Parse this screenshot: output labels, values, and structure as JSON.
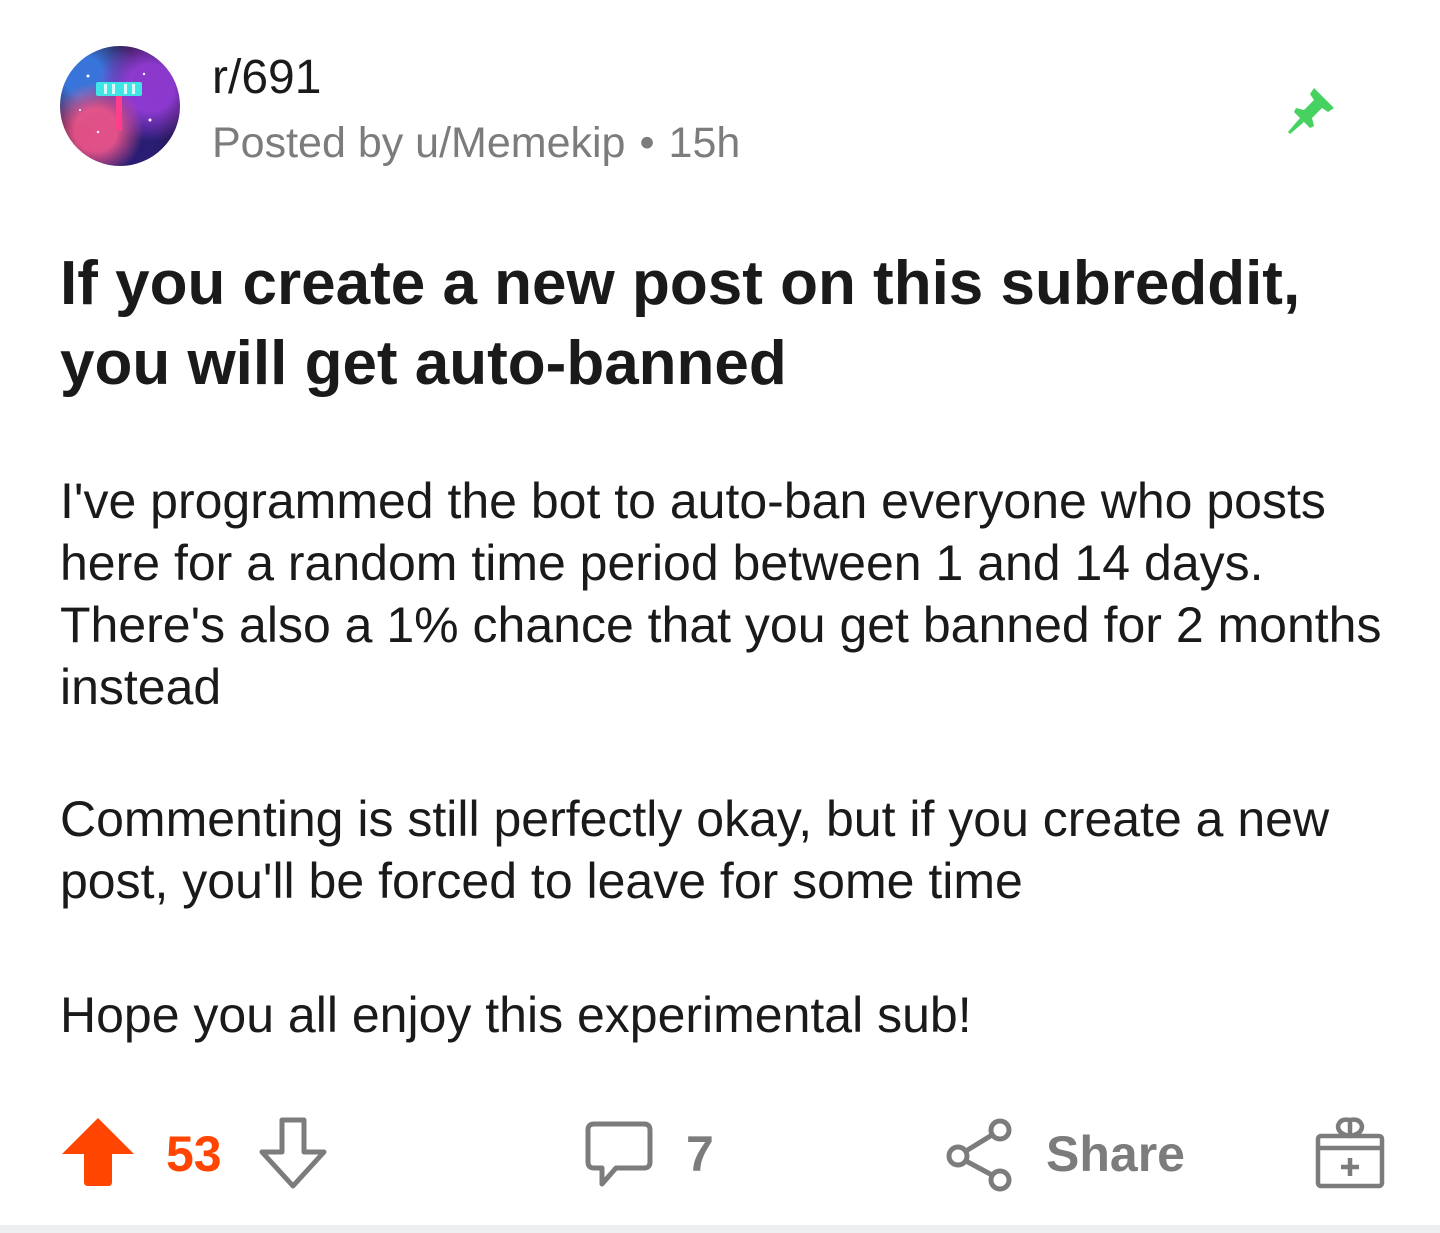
{
  "header": {
    "subreddit": "r/691",
    "posted_by": "Posted by u/Memekip",
    "separator": "•",
    "age": "15h"
  },
  "post": {
    "title": "If you create a new post on this subreddit, you will get auto-banned",
    "paragraphs": [
      "I've programmed the bot to auto-ban everyone who posts here for a random time period between 1 and 14 days. There's also a 1% chance that you get banned for 2 months instead",
      "Commenting is still perfectly okay, but if you create a new post, you'll be forced to leave for some time",
      "Hope you all enjoy this experimental sub!"
    ]
  },
  "actions": {
    "score": "53",
    "comment_count": "7",
    "share_label": "Share"
  },
  "colors": {
    "upvote_active": "#ff4500",
    "pin": "#46d160",
    "muted": "#7c7c7c",
    "text": "#1a1a1b"
  },
  "icons": {
    "avatar": "subreddit-avatar",
    "pin": "pin-icon",
    "upvote": "upvote-arrow-icon",
    "downvote": "downvote-arrow-icon",
    "comment": "comment-bubble-icon",
    "share": "share-icon",
    "award": "award-gift-icon"
  }
}
